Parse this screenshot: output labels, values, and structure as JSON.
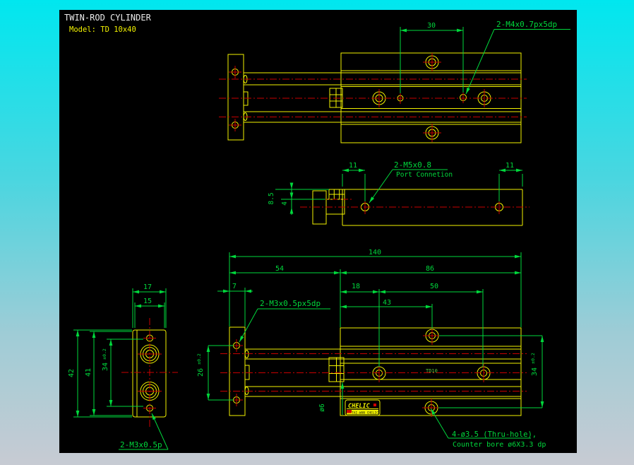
{
  "title": {
    "line1": "TWIN-ROD CYLINDER",
    "line2": "Model:  TD 10x40"
  },
  "top_view": {
    "dim_30": "30",
    "thread_label": "2-M4x0.7px5dp"
  },
  "side_view": {
    "dim_left": "11",
    "dim_right": "11",
    "port_line1": "2-M5x0.8",
    "port_line2": "Port Connetion",
    "dim_depth": "8.5",
    "dim_offset": "4"
  },
  "front_view": {
    "dim_total": "140",
    "dim_left": "54",
    "dim_right": "86",
    "dim_flange": "7",
    "dim_18": "18",
    "dim_50": "50",
    "dim_43": "43",
    "thread_label": "2-M3x0.5px5dp",
    "dim_26": "26",
    "dim_26_tol": "±0.2",
    "dim_34": "34",
    "dim_34_tol": "±0.2",
    "rod_dia": "ø6",
    "body_label": "TD10",
    "hole_note1": "4-ø3.5 (Thru-hole),",
    "hole_note2": "Counter bore ø6X3.3 dp",
    "logo_text": "CHELIC",
    "logo_subtext": "TAI-WAN CHELIC"
  },
  "end_view": {
    "dim_17": "17",
    "dim_15": "15",
    "dim_42": "42",
    "dim_41": "41",
    "dim_34": "34",
    "dim_34_tol": "±0.2",
    "thread_label": "2-M3x0.5p"
  },
  "colors": {
    "geometry": "#f2f200",
    "centerline": "#c80000",
    "dimension": "#00d83c",
    "title": "#ebebeb",
    "canvas": "#000000"
  }
}
